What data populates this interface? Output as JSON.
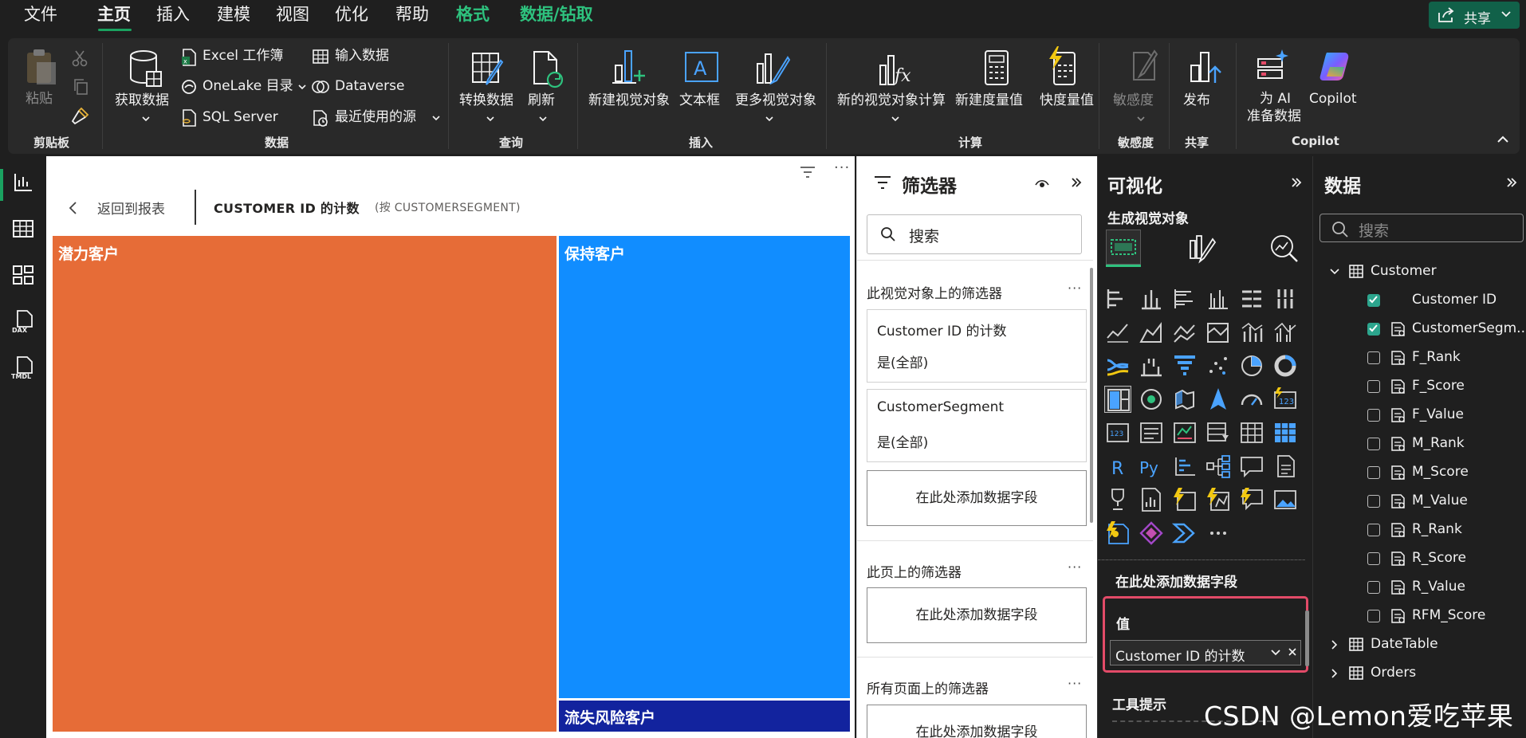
{
  "menu": {
    "items": [
      {
        "label": "文件",
        "style": "normal"
      },
      {
        "label": "主页",
        "style": "active"
      },
      {
        "label": "插入",
        "style": "normal"
      },
      {
        "label": "建模",
        "style": "normal"
      },
      {
        "label": "视图",
        "style": "normal"
      },
      {
        "label": "优化",
        "style": "normal"
      },
      {
        "label": "帮助",
        "style": "normal"
      },
      {
        "label": "格式",
        "style": "green"
      },
      {
        "label": "数据/钻取",
        "style": "green"
      }
    ],
    "share_label": "共享"
  },
  "ribbon": {
    "clipboard": {
      "paste": "粘贴",
      "group": "剪贴板"
    },
    "data": {
      "get_data": "获取数据",
      "excel": "Excel 工作簿",
      "onelake": "OneLake 目录",
      "sql": "SQL Server",
      "enter_data": "输入数据",
      "dataverse": "Dataverse",
      "recent": "最近使用的源",
      "group": "数据"
    },
    "queries": {
      "transform": "转换数据",
      "refresh": "刷新",
      "group": "查询"
    },
    "insert": {
      "new_visual": "新建视觉对象",
      "textbox": "文本框",
      "more_visuals": "更多视觉对象",
      "group": "插入"
    },
    "calc": {
      "new_visual_calc": "新的视觉对象计算",
      "new_measure": "新建度量值",
      "quick_measure": "快度量值",
      "group": "计算"
    },
    "sensitivity": {
      "label": "敏感度",
      "group": "敏感度"
    },
    "share": {
      "publish": "发布",
      "group": "共享"
    },
    "copilot": {
      "ai_line1": "为 AI",
      "ai_line2": "准备数据",
      "copilot": "Copilot",
      "group": "Copilot"
    }
  },
  "canvas": {
    "back_label": "返回到报表",
    "visual_title": "CUSTOMER ID 的计数",
    "visual_subtitle": "(按 CUSTOMERSEGMENT)",
    "treemap": [
      {
        "label": "潜力客户",
        "color": "#e66c37"
      },
      {
        "label": "保持客户",
        "color": "#118dff"
      },
      {
        "label": "流失风险客户",
        "color": "#12239e"
      }
    ]
  },
  "filters": {
    "title": "筛选器",
    "search_placeholder": "搜索",
    "visual_section": "此视觉对象上的筛选器",
    "cards": [
      {
        "field": "Customer ID 的计数",
        "state": "是(全部)"
      },
      {
        "field": "CustomerSegment",
        "state": "是(全部)"
      }
    ],
    "add_field": "在此处添加数据字段",
    "page_section": "此页上的筛选器",
    "all_pages_section": "所有页面上的筛选器"
  },
  "visualizations": {
    "title": "可视化",
    "build_label": "生成视觉对象",
    "add_field": "在此处添加数据字段",
    "values_label": "值",
    "values_field": "Customer ID 的计数",
    "tooltip_label": "工具提示"
  },
  "data_pane": {
    "title": "数据",
    "search_placeholder": "搜索",
    "tables": [
      {
        "name": "Customer",
        "expanded": true
      },
      {
        "name": "DateTable",
        "expanded": false
      },
      {
        "name": "Orders",
        "expanded": false
      }
    ],
    "fields": [
      {
        "name": "Customer ID",
        "checked": true
      },
      {
        "name": "CustomerSegm...",
        "checked": true
      },
      {
        "name": "F_Rank",
        "checked": false
      },
      {
        "name": "F_Score",
        "checked": false
      },
      {
        "name": "F_Value",
        "checked": false
      },
      {
        "name": "M_Rank",
        "checked": false
      },
      {
        "name": "M_Score",
        "checked": false
      },
      {
        "name": "M_Value",
        "checked": false
      },
      {
        "name": "R_Rank",
        "checked": false
      },
      {
        "name": "R_Score",
        "checked": false
      },
      {
        "name": "R_Value",
        "checked": false
      },
      {
        "name": "RFM_Score",
        "checked": false
      }
    ]
  },
  "watermark": "CSDN @Lemon爱吃苹果"
}
